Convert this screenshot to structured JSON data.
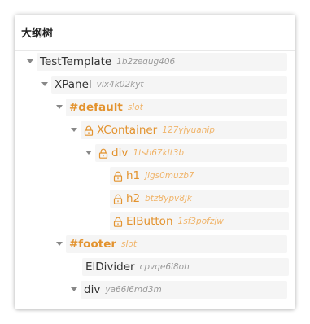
{
  "panel": {
    "title": "大纲树"
  },
  "tree": {
    "test_template": {
      "name": "TestTemplate",
      "id": "1b2zequg406"
    },
    "xpanel": {
      "name": "XPanel",
      "id": "vix4k02kyt"
    },
    "default_slot": {
      "name": "#default",
      "id": "slot"
    },
    "xcontainer": {
      "name": "XContainer",
      "id": "127yjyuanip"
    },
    "div_1": {
      "name": "div",
      "id": "1tsh67klt3b"
    },
    "h1": {
      "name": "h1",
      "id": "jigs0muzb7"
    },
    "h2": {
      "name": "h2",
      "id": "btz8ypv8jk"
    },
    "elbutton": {
      "name": "ElButton",
      "id": "1sf3pofzjw"
    },
    "footer_slot": {
      "name": "#footer",
      "id": "slot"
    },
    "eldivider": {
      "name": "ElDivider",
      "id": "cpvqe6i8oh"
    },
    "div_2": {
      "name": "div",
      "id": "ya66i6md3m"
    }
  },
  "colors": {
    "locked": "#e3932f",
    "locked_id": "#f0b46a",
    "text": "#333333",
    "id_text": "#9a9a9a",
    "row_bg": "#f5f5f5"
  },
  "icons": {
    "expand": "caret-down-icon",
    "lock": "lock-icon"
  }
}
